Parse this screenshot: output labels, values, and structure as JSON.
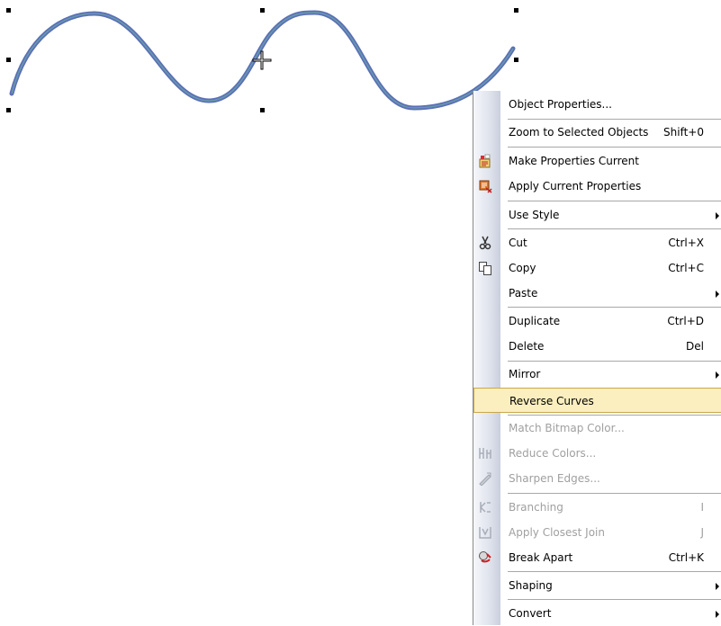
{
  "canvas": {
    "curve_color": "#5b6fb7",
    "curve_inner_color": "#6aa5a8"
  },
  "menu": {
    "items": [
      {
        "label": "Object Properties...",
        "shortcut": "",
        "submenu": false,
        "disabled": false,
        "icon": ""
      },
      {
        "label": "Zoom to Selected Objects",
        "shortcut": "Shift+0",
        "submenu": false,
        "disabled": false,
        "icon": ""
      },
      {
        "label": "Make Properties Current",
        "shortcut": "",
        "submenu": false,
        "disabled": false,
        "icon": "make-properties-current-icon"
      },
      {
        "label": "Apply Current Properties",
        "shortcut": "",
        "submenu": false,
        "disabled": false,
        "icon": "apply-current-properties-icon"
      },
      {
        "label": "Use Style",
        "shortcut": "",
        "submenu": true,
        "disabled": false,
        "icon": ""
      },
      {
        "label": "Cut",
        "shortcut": "Ctrl+X",
        "submenu": false,
        "disabled": false,
        "icon": "scissors-icon"
      },
      {
        "label": "Copy",
        "shortcut": "Ctrl+C",
        "submenu": false,
        "disabled": false,
        "icon": "copy-icon"
      },
      {
        "label": "Paste",
        "shortcut": "",
        "submenu": true,
        "disabled": false,
        "icon": ""
      },
      {
        "label": "Duplicate",
        "shortcut": "Ctrl+D",
        "submenu": false,
        "disabled": false,
        "icon": ""
      },
      {
        "label": "Delete",
        "shortcut": "Del",
        "submenu": false,
        "disabled": false,
        "icon": ""
      },
      {
        "label": "Mirror",
        "shortcut": "",
        "submenu": true,
        "disabled": false,
        "icon": ""
      },
      {
        "label": "Reverse Curves",
        "shortcut": "",
        "submenu": false,
        "disabled": false,
        "icon": "",
        "highlighted": true
      },
      {
        "label": "Match Bitmap Color...",
        "shortcut": "",
        "submenu": false,
        "disabled": true,
        "icon": ""
      },
      {
        "label": "Reduce Colors...",
        "shortcut": "",
        "submenu": false,
        "disabled": true,
        "icon": "reduce-colors-icon"
      },
      {
        "label": "Sharpen Edges...",
        "shortcut": "",
        "submenu": false,
        "disabled": true,
        "icon": "sharpen-edges-icon"
      },
      {
        "label": "Branching",
        "shortcut": "I",
        "submenu": false,
        "disabled": true,
        "icon": "branching-icon"
      },
      {
        "label": "Apply Closest Join",
        "shortcut": "J",
        "submenu": false,
        "disabled": true,
        "icon": "closest-join-icon"
      },
      {
        "label": "Break Apart",
        "shortcut": "Ctrl+K",
        "submenu": false,
        "disabled": false,
        "icon": "break-apart-icon"
      },
      {
        "label": "Shaping",
        "shortcut": "",
        "submenu": true,
        "disabled": false,
        "icon": ""
      },
      {
        "label": "Convert",
        "shortcut": "",
        "submenu": true,
        "disabled": false,
        "icon": ""
      }
    ],
    "highlight_color": "#fbeebf"
  }
}
